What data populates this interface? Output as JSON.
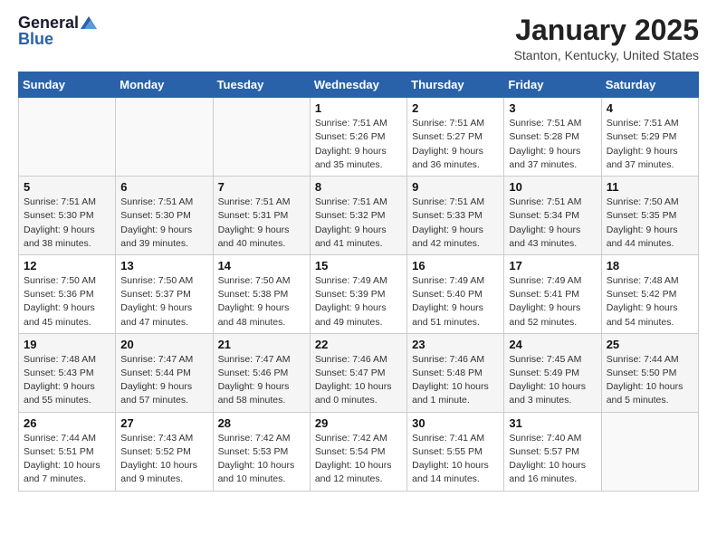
{
  "logo": {
    "general": "General",
    "blue": "Blue"
  },
  "title": {
    "month": "January 2025",
    "location": "Stanton, Kentucky, United States"
  },
  "weekdays": [
    "Sunday",
    "Monday",
    "Tuesday",
    "Wednesday",
    "Thursday",
    "Friday",
    "Saturday"
  ],
  "weeks": [
    [
      {
        "day": "",
        "info": ""
      },
      {
        "day": "",
        "info": ""
      },
      {
        "day": "",
        "info": ""
      },
      {
        "day": "1",
        "info": "Sunrise: 7:51 AM\nSunset: 5:26 PM\nDaylight: 9 hours\nand 35 minutes."
      },
      {
        "day": "2",
        "info": "Sunrise: 7:51 AM\nSunset: 5:27 PM\nDaylight: 9 hours\nand 36 minutes."
      },
      {
        "day": "3",
        "info": "Sunrise: 7:51 AM\nSunset: 5:28 PM\nDaylight: 9 hours\nand 37 minutes."
      },
      {
        "day": "4",
        "info": "Sunrise: 7:51 AM\nSunset: 5:29 PM\nDaylight: 9 hours\nand 37 minutes."
      }
    ],
    [
      {
        "day": "5",
        "info": "Sunrise: 7:51 AM\nSunset: 5:30 PM\nDaylight: 9 hours\nand 38 minutes."
      },
      {
        "day": "6",
        "info": "Sunrise: 7:51 AM\nSunset: 5:30 PM\nDaylight: 9 hours\nand 39 minutes."
      },
      {
        "day": "7",
        "info": "Sunrise: 7:51 AM\nSunset: 5:31 PM\nDaylight: 9 hours\nand 40 minutes."
      },
      {
        "day": "8",
        "info": "Sunrise: 7:51 AM\nSunset: 5:32 PM\nDaylight: 9 hours\nand 41 minutes."
      },
      {
        "day": "9",
        "info": "Sunrise: 7:51 AM\nSunset: 5:33 PM\nDaylight: 9 hours\nand 42 minutes."
      },
      {
        "day": "10",
        "info": "Sunrise: 7:51 AM\nSunset: 5:34 PM\nDaylight: 9 hours\nand 43 minutes."
      },
      {
        "day": "11",
        "info": "Sunrise: 7:50 AM\nSunset: 5:35 PM\nDaylight: 9 hours\nand 44 minutes."
      }
    ],
    [
      {
        "day": "12",
        "info": "Sunrise: 7:50 AM\nSunset: 5:36 PM\nDaylight: 9 hours\nand 45 minutes."
      },
      {
        "day": "13",
        "info": "Sunrise: 7:50 AM\nSunset: 5:37 PM\nDaylight: 9 hours\nand 47 minutes."
      },
      {
        "day": "14",
        "info": "Sunrise: 7:50 AM\nSunset: 5:38 PM\nDaylight: 9 hours\nand 48 minutes."
      },
      {
        "day": "15",
        "info": "Sunrise: 7:49 AM\nSunset: 5:39 PM\nDaylight: 9 hours\nand 49 minutes."
      },
      {
        "day": "16",
        "info": "Sunrise: 7:49 AM\nSunset: 5:40 PM\nDaylight: 9 hours\nand 51 minutes."
      },
      {
        "day": "17",
        "info": "Sunrise: 7:49 AM\nSunset: 5:41 PM\nDaylight: 9 hours\nand 52 minutes."
      },
      {
        "day": "18",
        "info": "Sunrise: 7:48 AM\nSunset: 5:42 PM\nDaylight: 9 hours\nand 54 minutes."
      }
    ],
    [
      {
        "day": "19",
        "info": "Sunrise: 7:48 AM\nSunset: 5:43 PM\nDaylight: 9 hours\nand 55 minutes."
      },
      {
        "day": "20",
        "info": "Sunrise: 7:47 AM\nSunset: 5:44 PM\nDaylight: 9 hours\nand 57 minutes."
      },
      {
        "day": "21",
        "info": "Sunrise: 7:47 AM\nSunset: 5:46 PM\nDaylight: 9 hours\nand 58 minutes."
      },
      {
        "day": "22",
        "info": "Sunrise: 7:46 AM\nSunset: 5:47 PM\nDaylight: 10 hours\nand 0 minutes."
      },
      {
        "day": "23",
        "info": "Sunrise: 7:46 AM\nSunset: 5:48 PM\nDaylight: 10 hours\nand 1 minute."
      },
      {
        "day": "24",
        "info": "Sunrise: 7:45 AM\nSunset: 5:49 PM\nDaylight: 10 hours\nand 3 minutes."
      },
      {
        "day": "25",
        "info": "Sunrise: 7:44 AM\nSunset: 5:50 PM\nDaylight: 10 hours\nand 5 minutes."
      }
    ],
    [
      {
        "day": "26",
        "info": "Sunrise: 7:44 AM\nSunset: 5:51 PM\nDaylight: 10 hours\nand 7 minutes."
      },
      {
        "day": "27",
        "info": "Sunrise: 7:43 AM\nSunset: 5:52 PM\nDaylight: 10 hours\nand 9 minutes."
      },
      {
        "day": "28",
        "info": "Sunrise: 7:42 AM\nSunset: 5:53 PM\nDaylight: 10 hours\nand 10 minutes."
      },
      {
        "day": "29",
        "info": "Sunrise: 7:42 AM\nSunset: 5:54 PM\nDaylight: 10 hours\nand 12 minutes."
      },
      {
        "day": "30",
        "info": "Sunrise: 7:41 AM\nSunset: 5:55 PM\nDaylight: 10 hours\nand 14 minutes."
      },
      {
        "day": "31",
        "info": "Sunrise: 7:40 AM\nSunset: 5:57 PM\nDaylight: 10 hours\nand 16 minutes."
      },
      {
        "day": "",
        "info": ""
      }
    ]
  ]
}
